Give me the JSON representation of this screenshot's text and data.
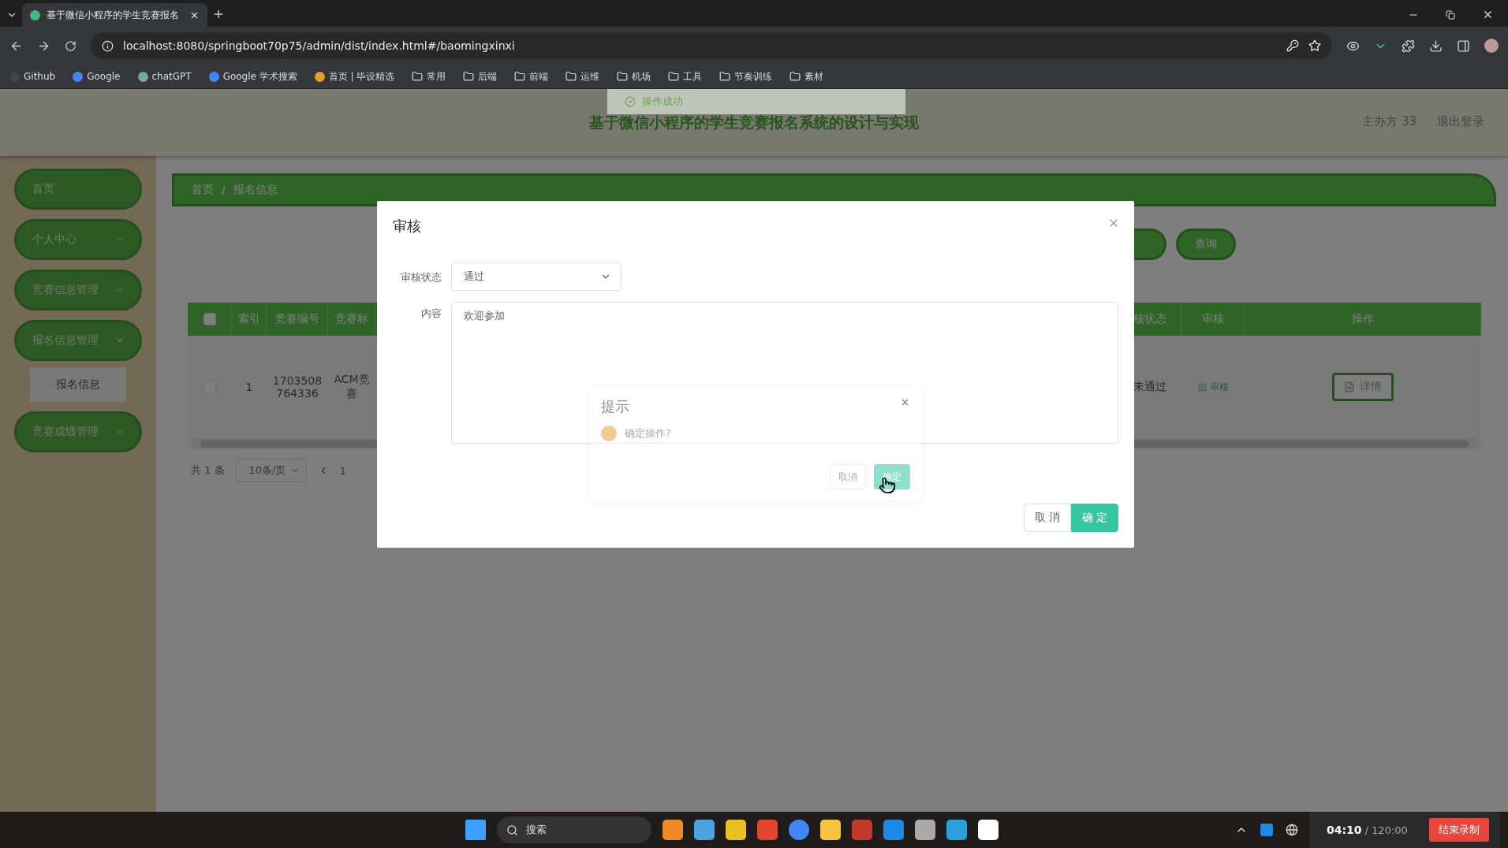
{
  "browser": {
    "tab_title": "基于微信小程序的学生竞赛报名",
    "url": "localhost:8080/springboot70p75/admin/dist/index.html#/baomingxinxi",
    "bookmarks": [
      {
        "label": "Github",
        "kind": "site"
      },
      {
        "label": "Google",
        "kind": "site"
      },
      {
        "label": "chatGPT",
        "kind": "site"
      },
      {
        "label": "Google 学术搜索",
        "kind": "site"
      },
      {
        "label": "首页 | 毕设精选",
        "kind": "site"
      },
      {
        "label": "常用",
        "kind": "folder"
      },
      {
        "label": "后端",
        "kind": "folder"
      },
      {
        "label": "前端",
        "kind": "folder"
      },
      {
        "label": "运维",
        "kind": "folder"
      },
      {
        "label": "机场",
        "kind": "folder"
      },
      {
        "label": "工具",
        "kind": "folder"
      },
      {
        "label": "节奏训练",
        "kind": "folder"
      },
      {
        "label": "素材",
        "kind": "folder"
      }
    ]
  },
  "toast": {
    "message": "操作成功"
  },
  "header": {
    "title": "基于微信小程序的学生竞赛报名系统的设计与实现",
    "user": "主办方 33",
    "logout": "退出登录"
  },
  "sidebar": {
    "items": [
      {
        "label": "首页",
        "kind": "link"
      },
      {
        "label": "个人中心",
        "kind": "submenu",
        "expanded": false
      },
      {
        "label": "竞赛信息管理",
        "kind": "submenu",
        "expanded": false
      },
      {
        "label": "报名信息管理",
        "kind": "submenu",
        "expanded": true,
        "children": [
          {
            "label": "报名信息",
            "selected": true
          }
        ]
      },
      {
        "label": "竞赛成绩管理",
        "kind": "submenu",
        "expanded": false
      }
    ]
  },
  "breadcrumb": [
    "首页",
    "报名信息"
  ],
  "breadcrumb_separator": "/",
  "search": {
    "button": "查询"
  },
  "table": {
    "select_all_checked": false,
    "left_columns": [
      "索引",
      "竞赛编号",
      "竞赛标"
    ],
    "right_columns": [
      "核状态",
      "审核",
      "操作"
    ],
    "rows": [
      {
        "checked": false,
        "index": "1",
        "code": "1703508764336",
        "title": "ACM竞赛",
        "status": "未通过",
        "review": "审核",
        "action": "详情"
      }
    ]
  },
  "pagination": {
    "total": "共 1 条",
    "page_size": "10条/页",
    "page": "1"
  },
  "dialog": {
    "title": "审核",
    "fields": [
      {
        "label": "审核状态",
        "kind": "select",
        "value": "通过"
      },
      {
        "label": "内容",
        "kind": "textarea",
        "value": "欢迎参加"
      }
    ],
    "cancel": "取 消",
    "confirm": "确 定"
  },
  "confirm_box": {
    "title": "提示",
    "message": "确定操作?",
    "cancel": "取消",
    "confirm": "确定"
  },
  "taskbar": {
    "search_placeholder": "搜索"
  },
  "recorder": {
    "elapsed": "04:10",
    "total": "/ 120:00",
    "stop": "结束录制"
  }
}
